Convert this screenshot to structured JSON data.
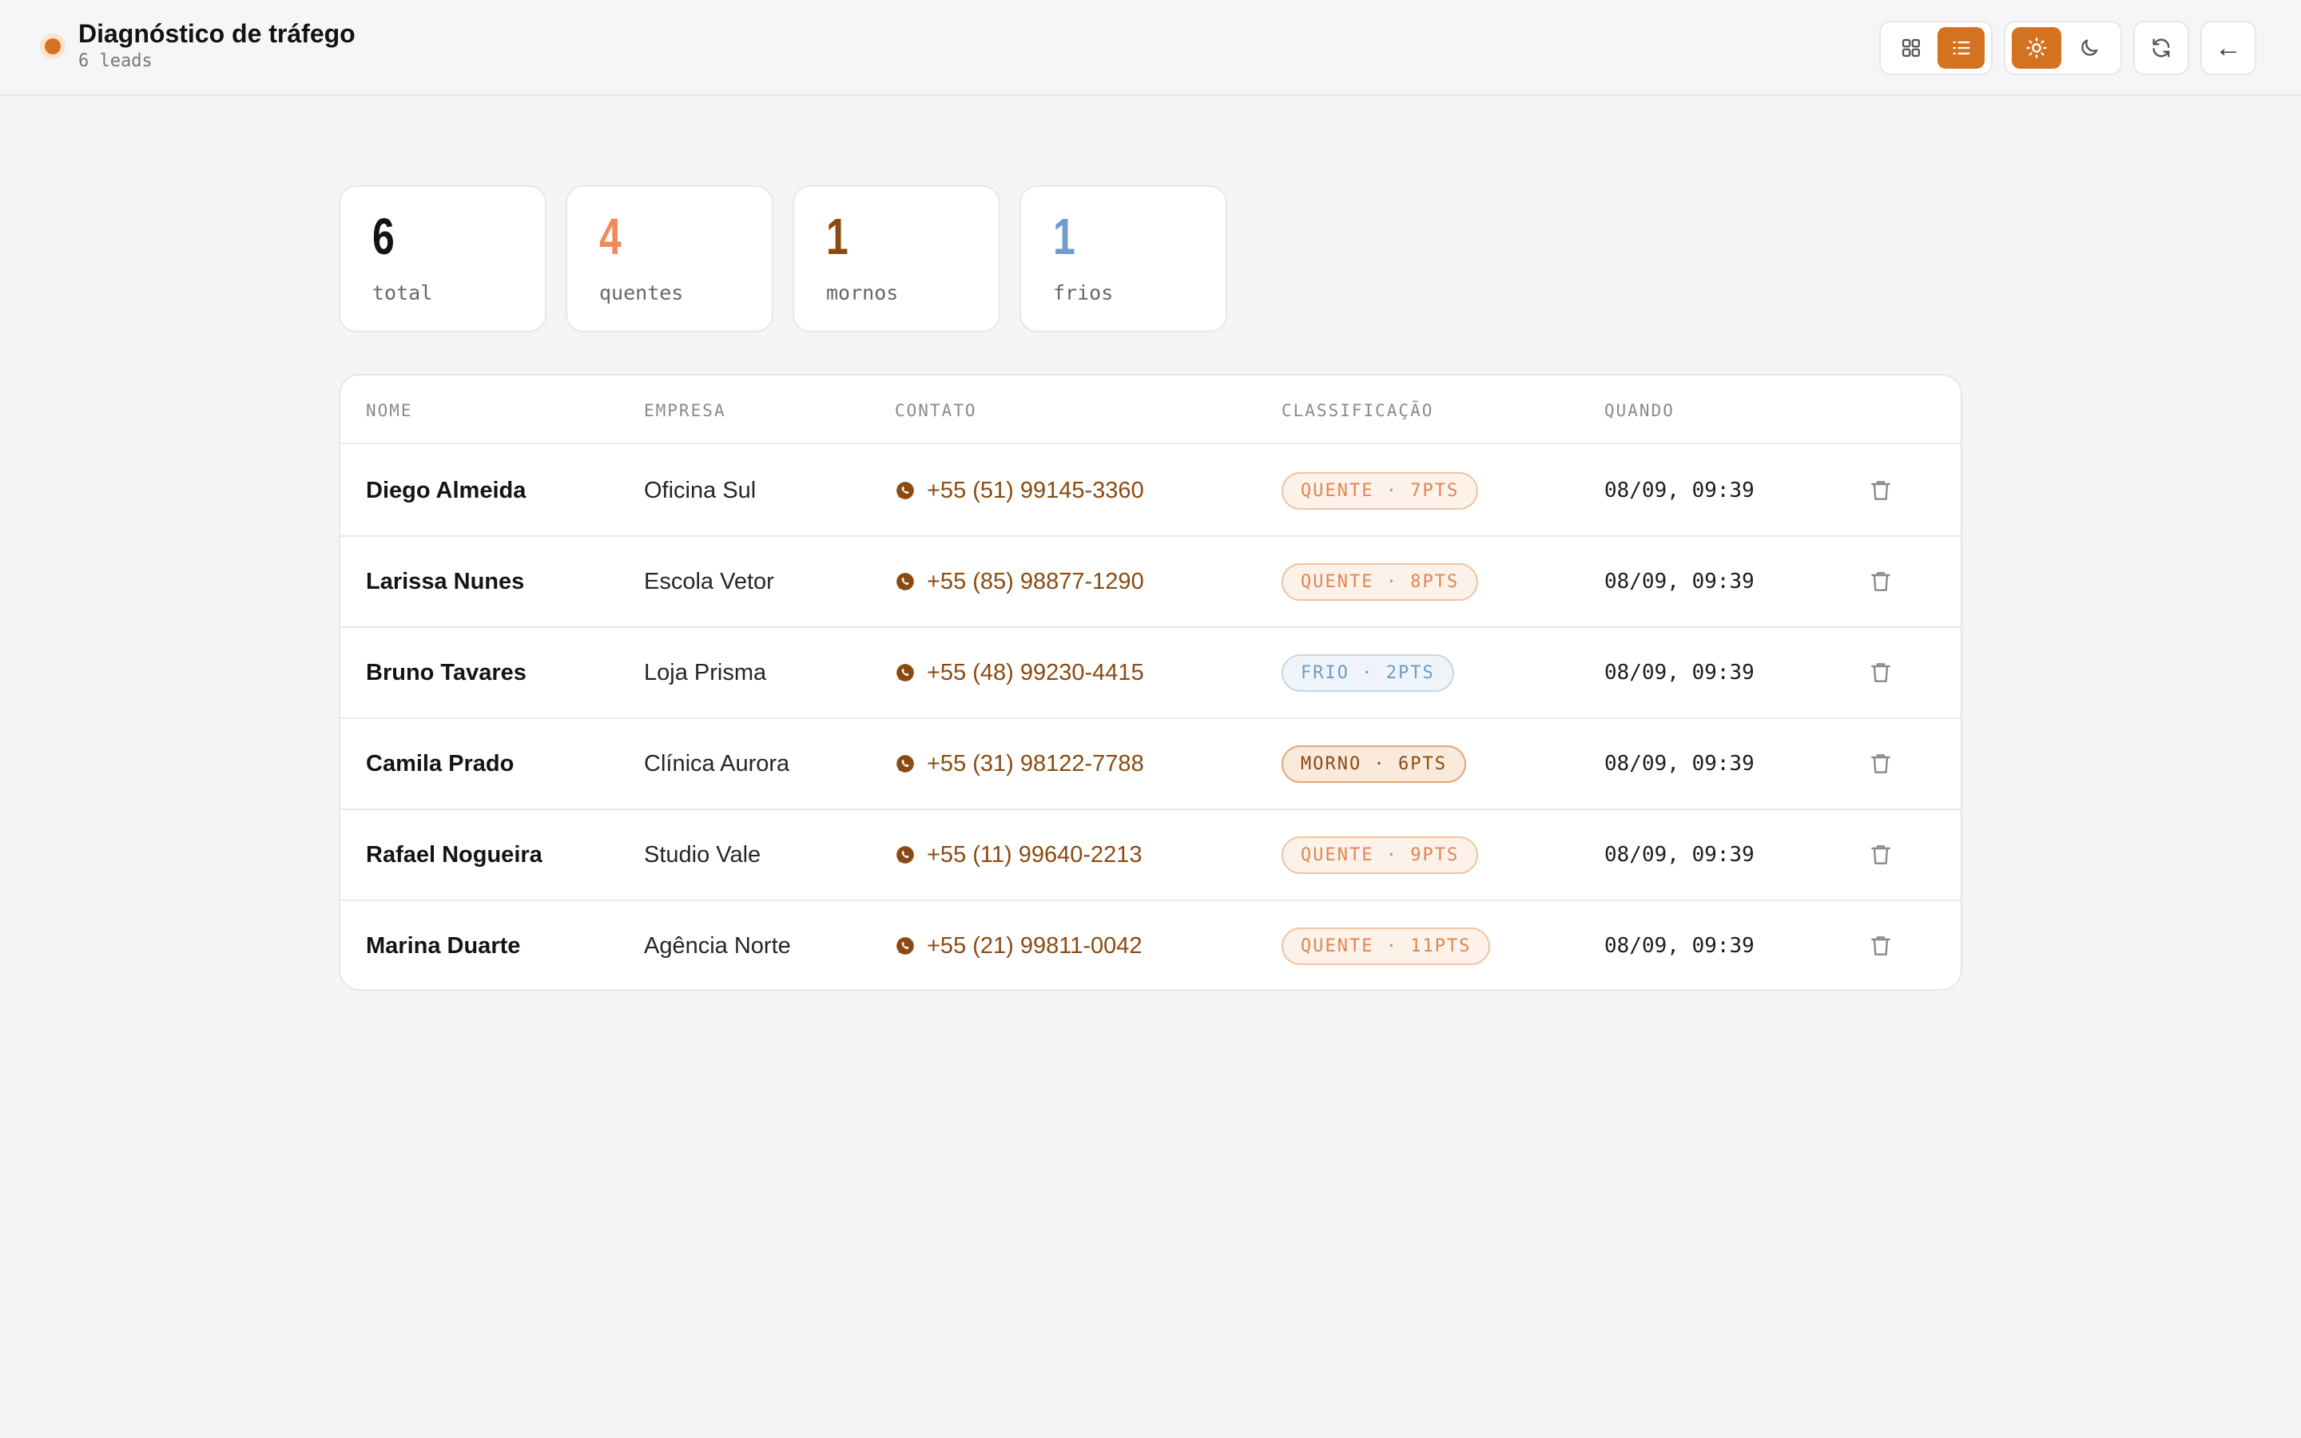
{
  "header": {
    "title": "Diagnóstico de tráfego",
    "subtitle": "6 leads",
    "back_label": "←"
  },
  "stats": [
    {
      "value": "6",
      "label": "total",
      "color": "#141414"
    },
    {
      "value": "4",
      "label": "quentes",
      "color": "#ef8a5a"
    },
    {
      "value": "1",
      "label": "mornos",
      "color": "#8b4a12"
    },
    {
      "value": "1",
      "label": "frios",
      "color": "#6f9cd0"
    }
  ],
  "table": {
    "headers": {
      "nome": "NOME",
      "empresa": "EMPRESA",
      "contato": "CONTATO",
      "classificacao": "CLASSIFICAÇÃO",
      "quando": "QUANDO"
    },
    "rows": [
      {
        "name": "Diego Almeida",
        "company": "Oficina Sul",
        "phone": "+55 (51) 99145-3360",
        "classification": "QUENTE · 7PTS",
        "tier": "quente",
        "when": "08/09, 09:39"
      },
      {
        "name": "Larissa Nunes",
        "company": "Escola Vetor",
        "phone": "+55 (85) 98877-1290",
        "classification": "QUENTE · 8PTS",
        "tier": "quente",
        "when": "08/09, 09:39"
      },
      {
        "name": "Bruno Tavares",
        "company": "Loja Prisma",
        "phone": "+55 (48) 99230-4415",
        "classification": "FRIO · 2PTS",
        "tier": "frio",
        "when": "08/09, 09:39"
      },
      {
        "name": "Camila Prado",
        "company": "Clínica Aurora",
        "phone": "+55 (31) 98122-7788",
        "classification": "MORNO · 6PTS",
        "tier": "morno",
        "when": "08/09, 09:39"
      },
      {
        "name": "Rafael Nogueira",
        "company": "Studio Vale",
        "phone": "+55 (11) 99640-2213",
        "classification": "QUENTE · 9PTS",
        "tier": "quente",
        "when": "08/09, 09:39"
      },
      {
        "name": "Marina Duarte",
        "company": "Agência Norte",
        "phone": "+55 (21) 99811-0042",
        "classification": "QUENTE · 11PTS",
        "tier": "quente",
        "when": "08/09, 09:39"
      }
    ]
  },
  "colors": {
    "accent": "#d4731f",
    "contact": "#8b4a12"
  },
  "icons": {
    "grid_view": "grid-icon",
    "list_view": "list-icon",
    "light_theme": "sun-icon",
    "dark_theme": "moon-icon",
    "refresh": "refresh-icon",
    "back": "arrow-left-icon",
    "contact": "whatsapp-icon",
    "delete": "trash-icon"
  }
}
